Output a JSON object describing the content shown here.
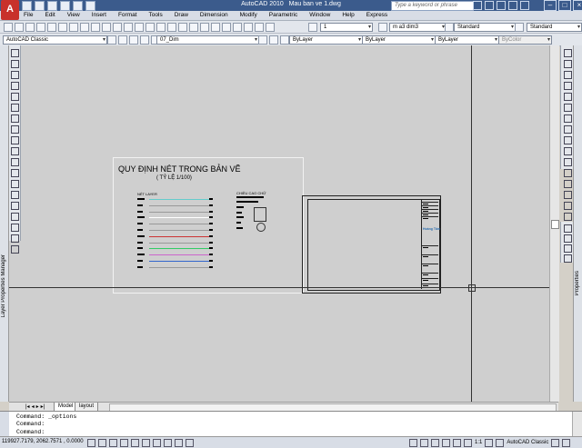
{
  "app": {
    "logo_letter": "A",
    "product": "AutoCAD 2010",
    "document": "Mau ban ve 1.dwg",
    "search_placeholder": "Type a keyword or phrase"
  },
  "menu": [
    "File",
    "Edit",
    "View",
    "Insert",
    "Format",
    "Tools",
    "Draw",
    "Dimension",
    "Modify",
    "Parametric",
    "Window",
    "Help",
    "Express"
  ],
  "toolbar_row1": {
    "dim_scale": "1",
    "dim_style": "m a3 dim3",
    "text_style": "Standard",
    "table_style": "Standard"
  },
  "toolbar_row2": {
    "workspace": "AutoCAD Classic",
    "layer": "07_Dim",
    "color_layer": "ByLayer",
    "linetype": "ByLayer",
    "lineweight": "ByLayer",
    "plotstyle": "ByColor"
  },
  "drawing": {
    "title": "QUY ĐỊNH NÉT TRONG BẢN VẼ",
    "scale_note": "( TỶ LỆ 1/100)",
    "left_header": "NÉT LAYER",
    "right_header": "CHIỀU CAO CHỮ",
    "logo_text": "Hoàng Tâm",
    "line_colors": [
      "#66cccc",
      "#999999",
      "#999999",
      "#ffffff",
      "#999999",
      "#999999",
      "#cc3333",
      "#999999",
      "#33cc66",
      "#cc66cc",
      "#3366cc",
      "#999999"
    ]
  },
  "panels": {
    "left_label": "Layer Properties Manager",
    "right_label": "Properties"
  },
  "tabs": {
    "model": "Model",
    "layout": "layout"
  },
  "command": {
    "line1": "Command: _options",
    "line2": "Command:",
    "line3": "Command:"
  },
  "status": {
    "coords": "119927.7179, 2062.7571 , 0.0000",
    "anno_scale": "1:1",
    "workspace": "AutoCAD Classic"
  },
  "colors": {
    "title_bar": "#3b5b8c",
    "canvas": "#cfcfcf",
    "logo_red": "#c8312b"
  }
}
